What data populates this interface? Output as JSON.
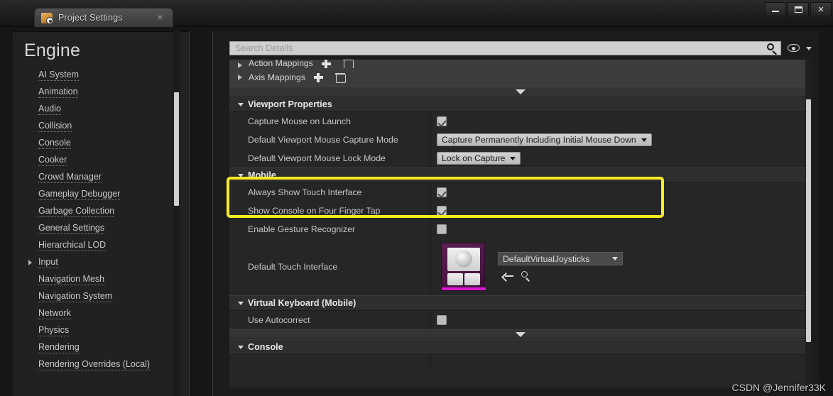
{
  "window": {
    "tab_title": "Project Settings",
    "tab_icon": "gear-folder-icon",
    "close_label": "×",
    "minimize_label": "minimize-icon",
    "maximize_label": "restore-icon",
    "close_btn_label": "✕"
  },
  "sidebar": {
    "title": "Engine",
    "items": [
      {
        "label": "AI System",
        "expandable": false
      },
      {
        "label": "Animation",
        "expandable": false
      },
      {
        "label": "Audio",
        "expandable": false
      },
      {
        "label": "Collision",
        "expandable": false
      },
      {
        "label": "Console",
        "expandable": false
      },
      {
        "label": "Cooker",
        "expandable": false
      },
      {
        "label": "Crowd Manager",
        "expandable": false
      },
      {
        "label": "Gameplay Debugger",
        "expandable": false
      },
      {
        "label": "Garbage Collection",
        "expandable": false
      },
      {
        "label": "General Settings",
        "expandable": false
      },
      {
        "label": "Hierarchical LOD",
        "expandable": false
      },
      {
        "label": "Input",
        "expandable": true
      },
      {
        "label": "Navigation Mesh",
        "expandable": false
      },
      {
        "label": "Navigation System",
        "expandable": false
      },
      {
        "label": "Network",
        "expandable": false
      },
      {
        "label": "Physics",
        "expandable": false
      },
      {
        "label": "Rendering",
        "expandable": false
      },
      {
        "label": "Rendering Overrides (Local)",
        "expandable": false
      }
    ]
  },
  "search": {
    "placeholder": "Search Details",
    "value": "",
    "search_icon": "magnifier-icon",
    "eye_icon": "eye-icon",
    "eye_dropdown_icon": "chevron-down-icon"
  },
  "details": {
    "top_rows": [
      {
        "label": "Action Mappings",
        "add_icon": "plus-icon",
        "delete_icon": "trash-icon"
      },
      {
        "label": "Axis Mappings",
        "add_icon": "plus-icon",
        "delete_icon": "trash-icon"
      }
    ],
    "sections": [
      {
        "name": "Viewport Properties",
        "rows": [
          {
            "label": "Capture Mouse on Launch",
            "type": "checkbox",
            "checked": true
          },
          {
            "label": "Default Viewport Mouse Capture Mode",
            "type": "combo",
            "value": "Capture Permanently Including Initial Mouse Down"
          },
          {
            "label": "Default Viewport Mouse Lock Mode",
            "type": "combo",
            "value": "Lock on Capture"
          }
        ]
      },
      {
        "name": "Mobile",
        "highlighted": true,
        "rows": [
          {
            "label": "Always Show Touch Interface",
            "type": "checkbox",
            "checked": true
          },
          {
            "label": "Show Console on Four Finger Tap",
            "type": "checkbox",
            "checked": true
          },
          {
            "label": "Enable Gesture Recognizer",
            "type": "checkbox",
            "checked": false
          },
          {
            "label": "Default Touch Interface",
            "type": "asset",
            "value": "DefaultVirtualJoysticks",
            "thumbnail": "virtual-joystick-thumbnail",
            "back_icon": "arrow-left-icon",
            "browse_icon": "magnifier-icon"
          }
        ]
      },
      {
        "name": "Virtual Keyboard (Mobile)",
        "rows": [
          {
            "label": "Use Autocorrect",
            "type": "checkbox",
            "checked": false
          }
        ]
      },
      {
        "name": "Console",
        "rows": []
      }
    ],
    "splitter_icon": "collapse-down-icon"
  },
  "watermark": "CSDN @Jennifer33K",
  "colors": {
    "highlight": "#f7ec21",
    "panel_bg": "#262626",
    "section_header": "#2e2e2e",
    "asset_accent": "#d81ad0"
  }
}
